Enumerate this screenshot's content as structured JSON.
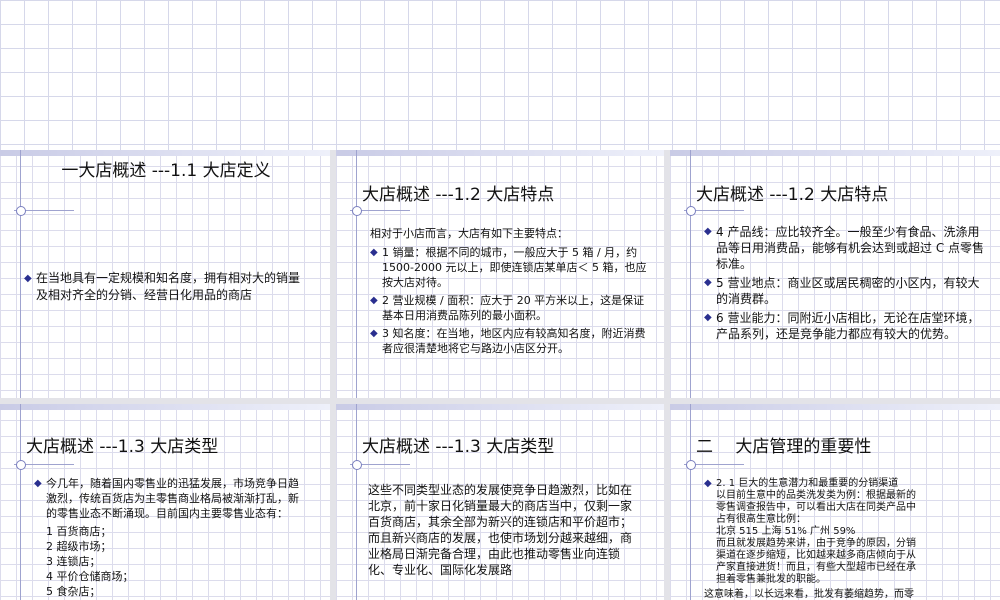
{
  "slides": [
    {
      "title": "一大店概述 ---1.1 大店定义",
      "bullets": [
        "在当地具有一定规模和知名度，拥有相对大的销量及相对齐全的分销、经营日化用品的商店"
      ]
    },
    {
      "title": "大店概述 ---1.2 大店特点",
      "intro": "相对于小店而言，大店有如下主要特点：",
      "bullets": [
        "1 销量：根据不同的城市，一般应大于 5 箱 / 月，约 1500-2000 元以上，即使连锁店某单店＜ 5 箱，也应按大店对待。",
        "2 营业规模 / 面积：应大于 20 平方米以上，这是保证基本日用消费品陈列的最小面积。",
        "3 知名度：在当地，地区内应有较高知名度，附近消费者应很清楚地将它与路边小店区分开。"
      ]
    },
    {
      "title": "大店概述 ---1.2 大店特点",
      "bullets": [
        "4 产品线：应比较齐全。一般至少有食品、洗涤用品等日用消费品，能够有机会达到或超过 C 点零售标准。",
        "5 营业地点：商业区或居民稠密的小区内，有较大的消费群。",
        "6 营业能力：同附近小店相比，无论在店堂环境，产品系列，还是竞争能力都应有较大的优势。"
      ]
    },
    {
      "title": "大店概述 ---1.3 大店类型",
      "bullets": [
        "今几年，随着国内零售业的迅猛发展，市场竞争日趋激烈，传统百货店为主零售商业格局被渐渐打乱，新的零售业态不断涌现。目前国内主要零售业态有："
      ],
      "list": [
        "1 百货商店；",
        "2 超级市场；",
        "3 连锁店；",
        "4 平价仓储商场；",
        "5 食杂店；"
      ]
    },
    {
      "title": "大店概述 ---1.3 大店类型",
      "paragraph": "这些不同类型业态的发展使竞争日趋激烈，比如在北京，前十家日化销量最大的商店当中，仅剩一家百货商店，其余全部为新兴的连锁店和平价超市；而且新兴商店的发展，也使市场划分越来越细，商业格局日渐完备合理，由此也推动零售业向连锁化、专业化、国际化发展路"
    },
    {
      "title": "二　 大店管理的重要性",
      "bullet": "2. 1 巨大的生意潜力和最重要的分销渠道",
      "sub_lines": [
        "以目前生意中的品类洗发类为例：根据最新的",
        "零售调查报告中，可以看出大店在同类产品中",
        "占有很高生意比例：",
        "北京  515  上海  51%  广州  59%",
        "而且就发展趋势来讲，由于竞争的原因，分销",
        "渠道在逐步缩短，比如越来越多商店倾向于从",
        "产家直接进货！而且，有些大型超市已经在承",
        "担着零售兼批发的职能。"
      ],
      "tail": "这意味着，以长远来看，批发有萎缩趋势，而零"
    }
  ]
}
